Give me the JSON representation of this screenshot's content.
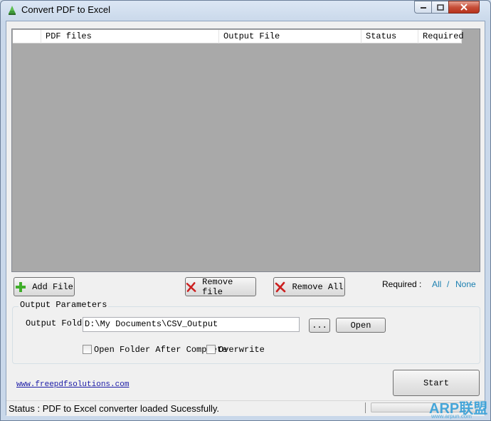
{
  "window": {
    "title": "Convert PDF to Excel"
  },
  "file_list": {
    "columns": [
      "",
      "PDF files",
      "Output File",
      "Status",
      "Required"
    ]
  },
  "toolbar": {
    "add_file_label": "Add File",
    "remove_file_label": "Remove file",
    "remove_all_label": "Remove All",
    "required_label": "Required :",
    "required_all": "All",
    "required_sep": "/",
    "required_none": "None"
  },
  "output_params": {
    "legend": "Output Parameters",
    "folder_label": "Output Folder",
    "folder_value": "D:\\My Documents\\CSV_Output",
    "browse_label": "...",
    "open_label": "Open",
    "open_folder_after_complete_label": "Open Folder After Complete",
    "open_folder_after_complete_checked": false,
    "overwrite_label": "Overwrite",
    "overwrite_checked": false
  },
  "footer": {
    "website": "www.freepdfsolutions.com",
    "start_label": "Start"
  },
  "status": {
    "text": "Status :  PDF to Excel converter loaded Sucessfully."
  },
  "watermark": {
    "text": "ARP联盟",
    "sub": "www.arpun.com"
  },
  "colors": {
    "list_bg": "#a9a9a9",
    "link_blue": "#1a7fb0",
    "add_green": "#3fae2a",
    "remove_red": "#cc2020"
  }
}
